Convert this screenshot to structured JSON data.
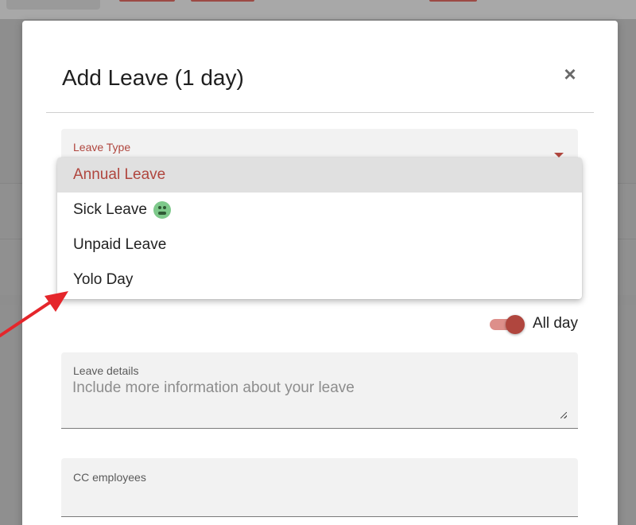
{
  "modal": {
    "title": "Add Leave (1 day)",
    "close_symbol": "×"
  },
  "leave_type": {
    "label": "Leave Type",
    "options": [
      {
        "label": "Annual Leave",
        "selected": true
      },
      {
        "label": "Sick Leave",
        "icon": "sick-face-icon"
      },
      {
        "label": "Unpaid Leave"
      },
      {
        "label": "Yolo Day"
      }
    ]
  },
  "all_day": {
    "label": "All day",
    "on": true
  },
  "leave_details": {
    "label": "Leave details",
    "placeholder": "Include more information about your leave"
  },
  "cc_employees": {
    "label": "CC employees"
  },
  "colors": {
    "accent": "#b0463e",
    "annotation_arrow": "#e5262b"
  }
}
